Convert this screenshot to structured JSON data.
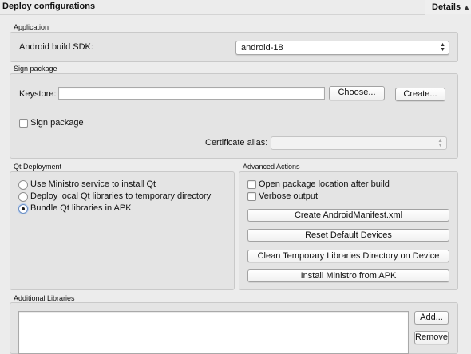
{
  "header": {
    "title": "Deploy configurations",
    "details_label": "Details"
  },
  "application": {
    "group_title": "Application",
    "sdk_label": "Android build SDK:",
    "sdk_value": "android-18"
  },
  "sign_package": {
    "group_title": "Sign package",
    "keystore_label": "Keystore:",
    "keystore_value": "",
    "choose_label": "Choose...",
    "create_label": "Create...",
    "sign_checkbox_label": "Sign package",
    "sign_checked": false,
    "alias_label": "Certificate alias:",
    "alias_value": ""
  },
  "qt_deployment": {
    "group_title": "Qt Deployment",
    "options": [
      {
        "label": "Use Ministro service to install Qt",
        "selected": false
      },
      {
        "label": "Deploy local Qt libraries to temporary directory",
        "selected": false
      },
      {
        "label": "Bundle Qt libraries in APK",
        "selected": true
      }
    ]
  },
  "advanced_actions": {
    "group_title": "Advanced Actions",
    "open_location_label": "Open package location after build",
    "verbose_label": "Verbose output",
    "buttons": [
      "Create AndroidManifest.xml",
      "Reset Default Devices",
      "Clean Temporary Libraries Directory on Device",
      "Install Ministro from APK"
    ]
  },
  "additional_libraries": {
    "group_title": "Additional Libraries",
    "add_label": "Add...",
    "remove_label": "Remove"
  }
}
